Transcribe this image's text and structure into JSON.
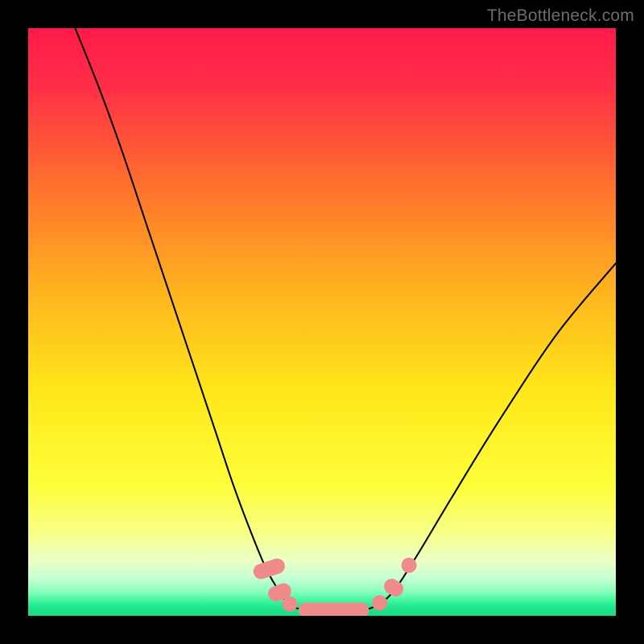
{
  "watermark": "TheBottleneck.com",
  "chart_data": {
    "type": "line",
    "title": "",
    "xlabel": "",
    "ylabel": "",
    "xlim": [
      0,
      100
    ],
    "ylim": [
      0,
      100
    ],
    "grid": false,
    "legend": false,
    "gradient_stops": [
      {
        "pos": 0.0,
        "color": "#ff1a4b"
      },
      {
        "pos": 0.1,
        "color": "#ff2f46"
      },
      {
        "pos": 0.25,
        "color": "#ff6a2f"
      },
      {
        "pos": 0.45,
        "color": "#ffb41e"
      },
      {
        "pos": 0.62,
        "color": "#ffe81a"
      },
      {
        "pos": 0.78,
        "color": "#fdff3a"
      },
      {
        "pos": 0.86,
        "color": "#f7ff88"
      },
      {
        "pos": 0.905,
        "color": "#ecffc4"
      },
      {
        "pos": 0.935,
        "color": "#c7ffd4"
      },
      {
        "pos": 0.958,
        "color": "#8dffbe"
      },
      {
        "pos": 0.972,
        "color": "#4cf7a3"
      },
      {
        "pos": 0.985,
        "color": "#1fe98e"
      },
      {
        "pos": 1.0,
        "color": "#16db82"
      }
    ],
    "series": [
      {
        "name": "left-branch",
        "x": [
          8,
          12,
          16,
          20,
          24,
          28,
          32,
          35,
          38,
          40.5,
          42.5,
          44,
          45
        ],
        "y": [
          100,
          90,
          79,
          67,
          55,
          43,
          31,
          22,
          14,
          8,
          4.5,
          2.2,
          1.5
        ]
      },
      {
        "name": "valley-floor",
        "x": [
          45,
          48,
          52,
          56,
          59
        ],
        "y": [
          1.5,
          0.9,
          0.8,
          0.9,
          1.6
        ]
      },
      {
        "name": "right-branch",
        "x": [
          59,
          62,
          66,
          72,
          80,
          90,
          100
        ],
        "y": [
          1.6,
          4,
          10,
          20,
          33,
          48,
          60
        ]
      }
    ],
    "markers": [
      {
        "name": "left-cluster-top",
        "shape": "capsule",
        "color": "#ef8b8b",
        "cx": 41.0,
        "cy": 8.0,
        "w": 2.6,
        "h": 5.5,
        "angle": 72
      },
      {
        "name": "left-cluster-mid",
        "shape": "capsule",
        "color": "#ef8b8b",
        "cx": 42.8,
        "cy": 4.0,
        "w": 2.6,
        "h": 4.0,
        "angle": 70
      },
      {
        "name": "left-cluster-low",
        "shape": "dot",
        "color": "#ef8b8b",
        "cx": 44.5,
        "cy": 2.0,
        "r": 1.3
      },
      {
        "name": "floor-bar",
        "shape": "capsule",
        "color": "#ef8b8b",
        "cx": 52.0,
        "cy": 0.95,
        "w": 12.0,
        "h": 2.6,
        "angle": 0
      },
      {
        "name": "right-cluster-low",
        "shape": "dot",
        "color": "#ef8b8b",
        "cx": 59.8,
        "cy": 2.2,
        "r": 1.3
      },
      {
        "name": "right-cluster-mid",
        "shape": "capsule",
        "color": "#ef8b8b",
        "cx": 62.2,
        "cy": 4.8,
        "w": 2.6,
        "h": 3.4,
        "angle": -60
      },
      {
        "name": "right-cluster-top",
        "shape": "dot",
        "color": "#ef8b8b",
        "cx": 64.8,
        "cy": 8.6,
        "r": 1.3
      }
    ]
  }
}
